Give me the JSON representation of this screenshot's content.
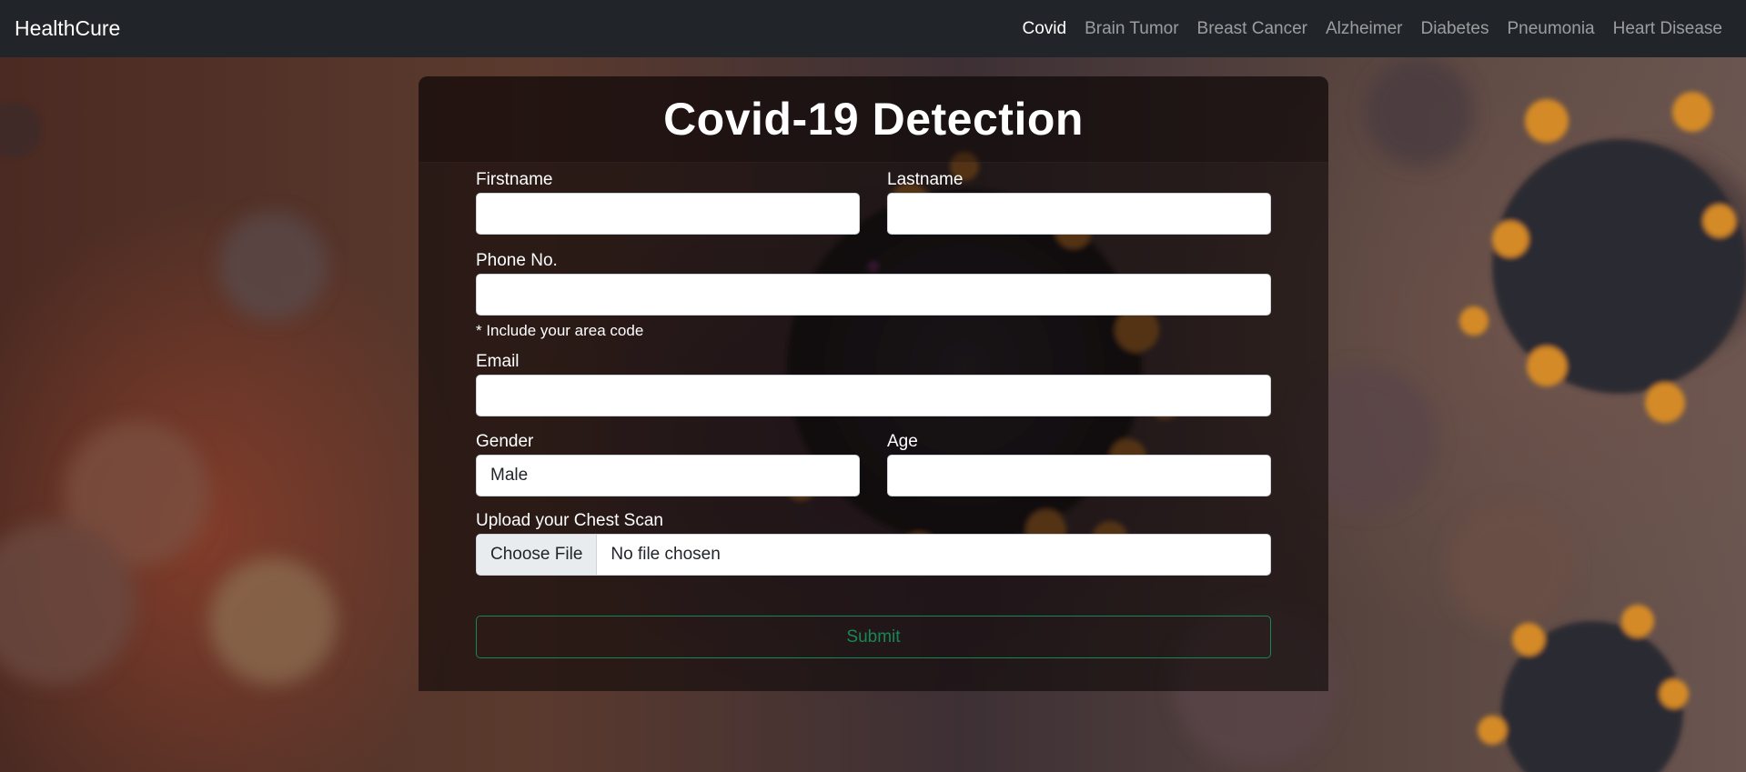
{
  "navbar": {
    "brand": "HealthCure",
    "links": [
      {
        "label": "Covid",
        "active": true
      },
      {
        "label": "Brain Tumor"
      },
      {
        "label": "Breast Cancer"
      },
      {
        "label": "Alzheimer"
      },
      {
        "label": "Diabetes"
      },
      {
        "label": "Pneumonia"
      },
      {
        "label": "Heart Disease"
      }
    ]
  },
  "form": {
    "title": "Covid-19 Detection",
    "firstname_label": "Firstname",
    "firstname_value": "",
    "lastname_label": "Lastname",
    "lastname_value": "",
    "phone_label": "Phone No.",
    "phone_value": "",
    "phone_help": "* Include your area code",
    "email_label": "Email",
    "email_value": "",
    "gender_label": "Gender",
    "gender_value": "Male",
    "age_label": "Age",
    "age_value": "",
    "upload_label": "Upload your Chest Scan",
    "file_button": "Choose File",
    "file_status": "No file chosen",
    "submit_label": "Submit"
  },
  "colors": {
    "navbar_bg": "#212529",
    "submit_accent": "#198754"
  }
}
